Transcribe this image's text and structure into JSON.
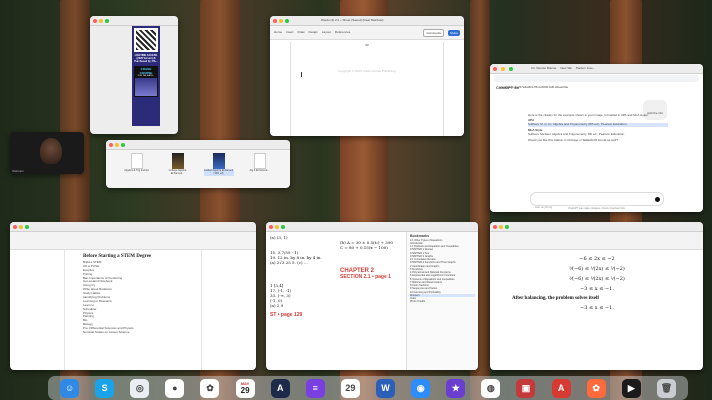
{
  "wallpaper": {
    "theme": "redwood forest"
  },
  "windows": {
    "image_viewer": {
      "ad_text": "LIFETIME ACCESS\n(2020 Version) $\nPurchased by: PA...",
      "book_title": "CRASH COURSE",
      "book_subtitle": "FOR THE MATH..."
    },
    "word_top": {
      "title": "Words (2) 2.2 ~ Sheet (Saved) (Dear Rainbow)",
      "tabs": [
        "Home",
        "Insert",
        "Draw",
        "Design",
        "Layout",
        "References",
        "Mailings",
        "Review",
        "View"
      ],
      "comments_label": "Comments",
      "share_label": "Share",
      "footer_text": "Copyright © 2023 Crash Course Publishing",
      "page_number": "50"
    },
    "chat": {
      "tab1": "Ch. Rennie Dianne",
      "tab2": "New Tab",
      "tab3": "Pardon Jose...",
      "url": "chatgpt.com/c/67a3a3b9-78cd-8000-9dff-2deac64e",
      "app_name": "ChatGPT 4o",
      "user_message": "Add the nilo",
      "reply_intro": "Here is the citation for the example shown in your image, formatted in APA and MLA styles:",
      "apa_heading": "APA",
      "apa_line": "Sullivan, M. (n.d.). Algebra and Trigonometry (8th ed.). Pearson Education.",
      "mla_heading": "MLA Style",
      "mla_line": "Sullivan, Michael. Algebra and Trigonometry. 8th ed., Pearson Education.",
      "followup": "Would you like this citation in Chicago or IEEE/ACM format as well?",
      "input_placeholder": "Ask anything",
      "disclaimer": "ChatGPT can make mistakes. Check important info."
    },
    "finder": {
      "files": [
        "Algebra & Trig 2nd Ed",
        "College Algebra Enhanced...",
        "Guided Algebra Enhanced (10th ed)",
        "Alg 2 Enhanced..."
      ]
    },
    "word_left": {
      "heading": "Before Starting a STEM Degree",
      "items": [
        "Build a STEM",
        "2D to PUSH",
        "Ecopilot",
        "Pricing",
        "Ban Importance of Pondering",
        "Get-a-Hand Notebook",
        "Using Cy",
        "Write about Rotations",
        "Study Habits",
        "Identifying Problems",
        "Learning to Research",
        "Learn to",
        "Scheduler",
        "Physics",
        "Painting",
        "Bio",
        "Biology",
        "Pre: Differential Sciences and Physics",
        "Nominal Scales on Lesser Science"
      ]
    },
    "pdf_viewer": {
      "chapter_label": "CHAPTER 2",
      "section_label": "SECTION 2.1 • page 1",
      "page_label": "ST • page 129",
      "sidebar_title": "Bookmarks",
      "sidebar_items": [
        "2.1 Other Types of Equations",
        "Introduction",
        "1.1 Radicals and Equations and Inequalities",
        "CHAPTER 1 Review",
        "CHAPTER 1 Test",
        "CHAPTER 2 Graphs",
        "2.1 Cumulative Review",
        "CHAPTER 2 Functions and Their Graphs",
        "2 Coordinates and Graphs",
        "3 Functions",
        "4 Polynomial and Rational Functions",
        "5 Exponential and Logarithmic Functions",
        "6 Systems of Equations and Inequalities",
        "7 Matrices and Determinants",
        "8 Conic Sections",
        "9 Sequences and Series",
        "10 Counting and Probability",
        "Answers",
        "Index",
        "Photo Credits"
      ],
      "math_lines": [
        "(a) (3, 1)",
        "(d) 1, 1/",
        "tiple",
        "(b) A = 30 ± 0.5(t₂) + 390",
        "C = 80 + 0.15(x − 100)",
        "C = 845.97 answers: A = ...",
        "15. 3,7/59 - 1)",
        "19. 12 in. by 8 in. by 4 in.",
        "(a) 2√3.25 5. (c) ...",
        "25. √3(x)",
        "1. 10 Yy",
        "1 [3, -1]",
        "1 [3,4]",
        "17. (-1, -1)",
        "33. (-∞, 3)",
        "(-1, 0)",
        "(a) 2.9"
      ]
    },
    "word_right": {
      "equations": [
        "−6 ≤ 2x ≤ −2",
        "⅟(−6) ≤ ⅟(2x) ≤ ⅟(−2)",
        "⅟(−6) ≤ ⅟(2x) ≤ ⅟(−2)",
        "−3 ≤ x ≤ −1."
      ],
      "body_text": "After balancing, the problem solves itself",
      "answer_line": "−3 ≤ x ≤ −1."
    },
    "webcam": {
      "label": "Webcam"
    }
  },
  "dock": {
    "apps": [
      {
        "name": "Finder",
        "color": "#2f8ae5",
        "glyph": "☺"
      },
      {
        "name": "Skype",
        "color": "#1aa3e8",
        "glyph": "S"
      },
      {
        "name": "Safari",
        "color": "#eaeef2",
        "glyph": "◎"
      },
      {
        "name": "Chrome",
        "color": "#ffffff",
        "glyph": "●"
      },
      {
        "name": "Photos",
        "color": "#ffffff",
        "glyph": "✿"
      },
      {
        "name": "Calendar",
        "color": "#ffffff",
        "glyph": "31"
      },
      {
        "name": "Affinity",
        "color": "#1e2a4a",
        "glyph": "A"
      },
      {
        "name": "Notes",
        "color": "#7a3fe0",
        "glyph": "≡"
      },
      {
        "name": "Calendar",
        "color": "#ffffff",
        "glyph": "29"
      },
      {
        "name": "Word",
        "color": "#2b5fb8",
        "glyph": "W"
      },
      {
        "name": "Zoom",
        "color": "#2d8cff",
        "glyph": "◉"
      },
      {
        "name": "iMovie",
        "color": "#6a3fd0",
        "glyph": "★"
      },
      {
        "name": "Ear",
        "color": "#ffffff",
        "glyph": "◍"
      },
      {
        "name": "Photo Booth",
        "color": "#c43a3a",
        "glyph": "▣"
      },
      {
        "name": "Acrobat",
        "color": "#d63a32",
        "glyph": "A"
      },
      {
        "name": "Vivaldi",
        "color": "#ff6a3c",
        "glyph": "✿"
      },
      {
        "name": "Terminal",
        "color": "#1b1b1b",
        "glyph": "▶"
      },
      {
        "name": "Trash",
        "color": "#c9ccd0",
        "glyph": "🗑"
      }
    ],
    "calendar_month": "MAY",
    "calendar_day": "29"
  }
}
